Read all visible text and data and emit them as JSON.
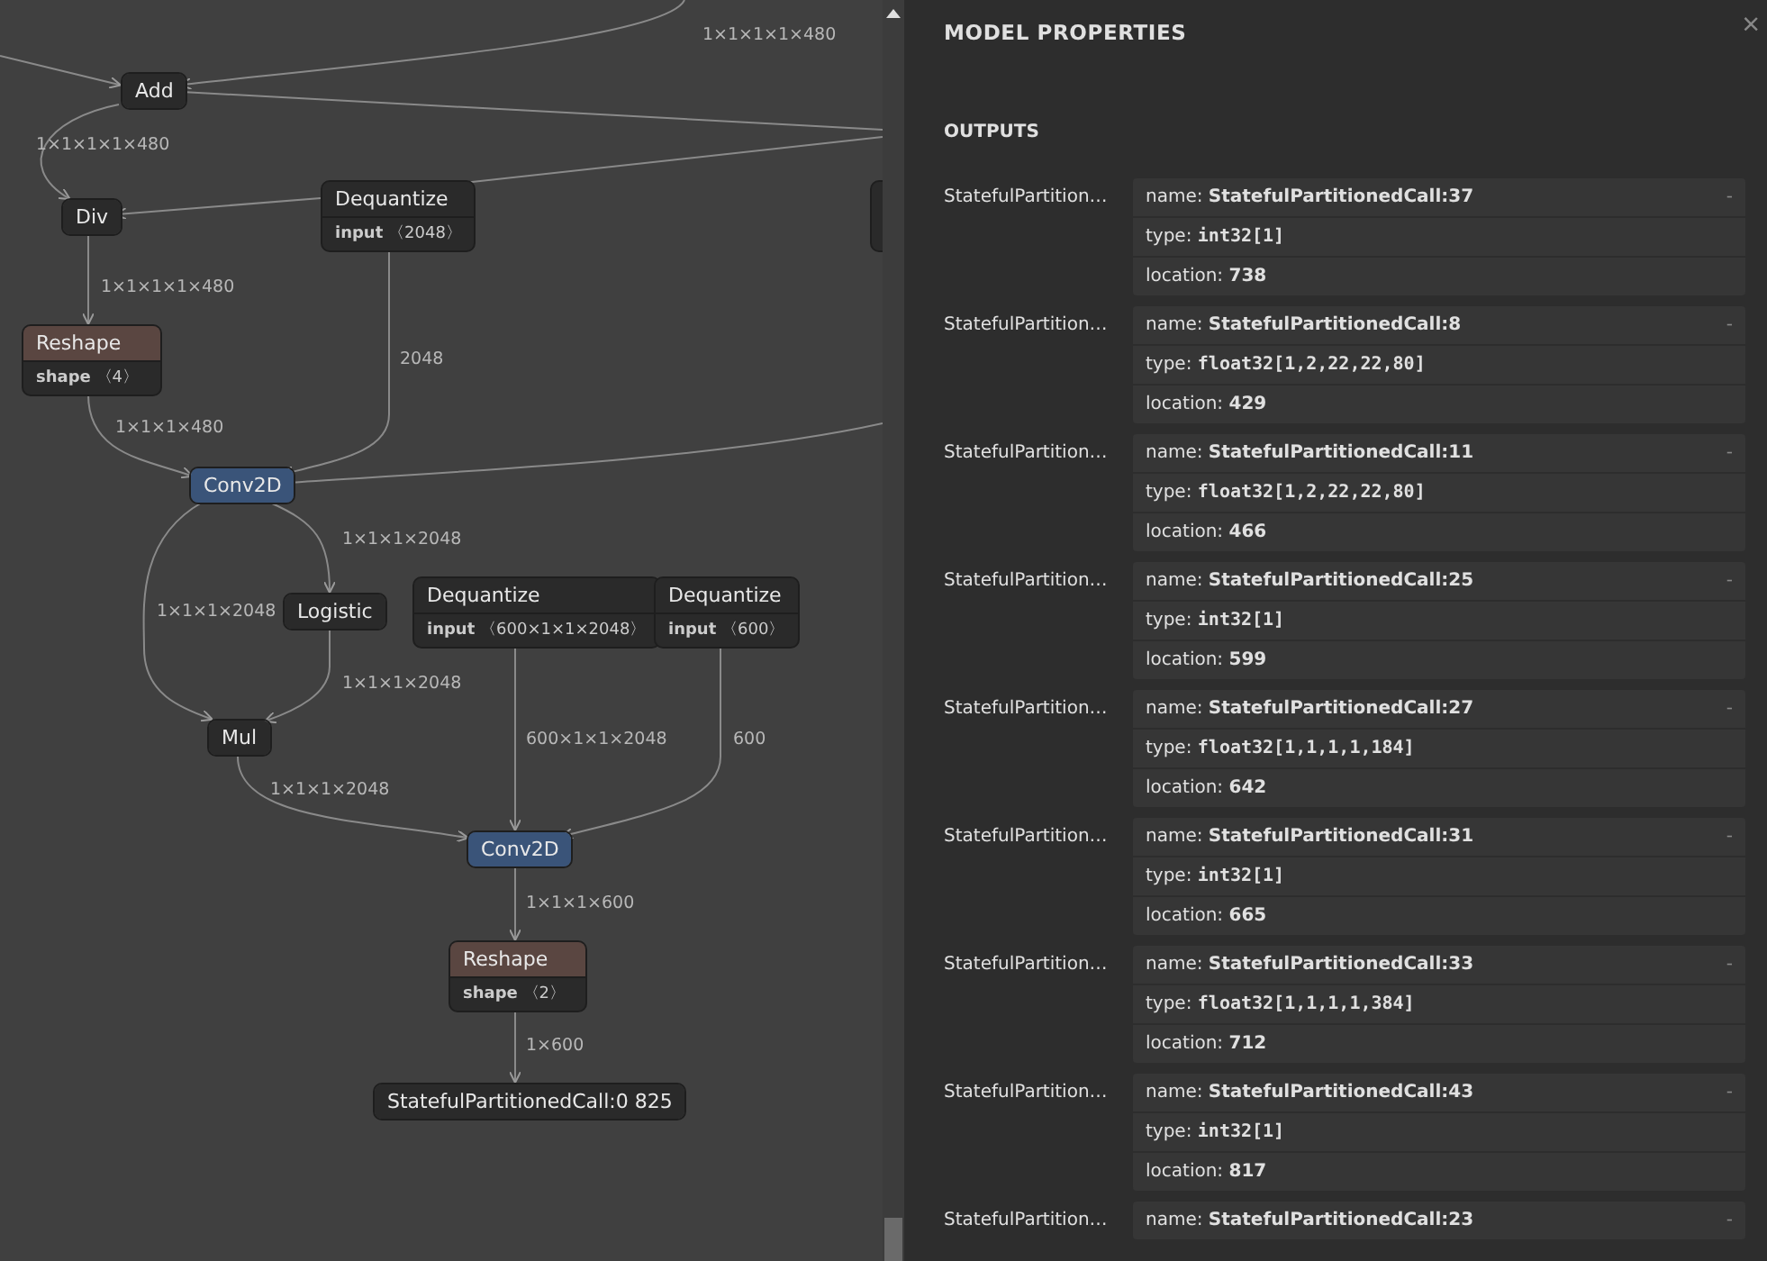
{
  "graph": {
    "nodes": [
      {
        "title": "Add",
        "color": "#2a2a2a"
      },
      {
        "title": "Div",
        "color": "#2a2a2a"
      },
      {
        "title": "Dequantize",
        "color": "#2a2a2a",
        "attribute": {
          "name": "input",
          "value": "〈2048〉"
        }
      },
      {
        "title": "Reshape",
        "color": "#5a4641",
        "attribute": {
          "name": "shape",
          "value": "〈4〉"
        }
      },
      {
        "title": "Conv2D",
        "color": "#3a5479"
      },
      {
        "title": "Logistic",
        "color": "#2a2a2a"
      },
      {
        "title": "Dequantize",
        "color": "#2a2a2a",
        "attribute": {
          "name": "input",
          "value": "〈600×1×1×2048〉"
        }
      },
      {
        "title": "Dequantize",
        "color": "#2a2a2a",
        "attribute": {
          "name": "input",
          "value": "〈600〉"
        }
      },
      {
        "title": "Mul",
        "color": "#2a2a2a"
      },
      {
        "title": "Conv2D",
        "color": "#3a5479"
      },
      {
        "title": "Reshape",
        "color": "#5a4641",
        "attribute": {
          "name": "shape",
          "value": "〈2〉"
        }
      },
      {
        "title": "StatefulPartitionedCall:0 825",
        "color": "#2a2a2a"
      }
    ],
    "edge_labels": [
      "1×1×1×1×480",
      "1×1×1×1×480",
      "1×1×1×1×480",
      "2048",
      "1×1×1×480",
      "1×1×1×2048",
      "1×1×1×2048",
      "1×1×1×2048",
      "600×1×1×2048",
      "600",
      "1×1×1×2048",
      "1×1×1×600",
      "1×600"
    ]
  },
  "panel": {
    "title": "MODEL PROPERTIES",
    "close": "×",
    "section": "OUTPUTS",
    "outputs": [
      {
        "label": "StatefulPartition…",
        "name_label": "name:",
        "name": "StatefulPartitionedCall:37",
        "type_label": "type:",
        "type": "int32[1]",
        "location_label": "location:",
        "location": "738",
        "collapse": "-"
      },
      {
        "label": "StatefulPartition…",
        "name_label": "name:",
        "name": "StatefulPartitionedCall:8",
        "type_label": "type:",
        "type": "float32[1,2,22,22,80]",
        "location_label": "location:",
        "location": "429",
        "collapse": "-"
      },
      {
        "label": "StatefulPartition…",
        "name_label": "name:",
        "name": "StatefulPartitionedCall:11",
        "type_label": "type:",
        "type": "float32[1,2,22,22,80]",
        "location_label": "location:",
        "location": "466",
        "collapse": "-"
      },
      {
        "label": "StatefulPartition…",
        "name_label": "name:",
        "name": "StatefulPartitionedCall:25",
        "type_label": "type:",
        "type": "int32[1]",
        "location_label": "location:",
        "location": "599",
        "collapse": "-"
      },
      {
        "label": "StatefulPartition…",
        "name_label": "name:",
        "name": "StatefulPartitionedCall:27",
        "type_label": "type:",
        "type": "float32[1,1,1,1,184]",
        "location_label": "location:",
        "location": "642",
        "collapse": "-"
      },
      {
        "label": "StatefulPartition…",
        "name_label": "name:",
        "name": "StatefulPartitionedCall:31",
        "type_label": "type:",
        "type": "int32[1]",
        "location_label": "location:",
        "location": "665",
        "collapse": "-"
      },
      {
        "label": "StatefulPartition…",
        "name_label": "name:",
        "name": "StatefulPartitionedCall:33",
        "type_label": "type:",
        "type": "float32[1,1,1,1,384]",
        "location_label": "location:",
        "location": "712",
        "collapse": "-"
      },
      {
        "label": "StatefulPartition…",
        "name_label": "name:",
        "name": "StatefulPartitionedCall:43",
        "type_label": "type:",
        "type": "int32[1]",
        "location_label": "location:",
        "location": "817",
        "collapse": "-"
      },
      {
        "label": "StatefulPartition…",
        "name_label": "name:",
        "name": "StatefulPartitionedCall:23",
        "collapse": "-"
      }
    ]
  }
}
